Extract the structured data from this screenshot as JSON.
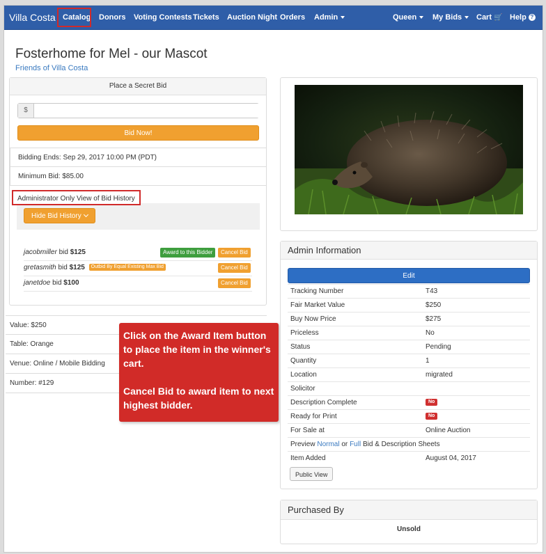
{
  "nav": {
    "brand": "Villa Costa",
    "items": [
      "Catalog",
      "Donors",
      "Voting Contests",
      "Tickets",
      "Auction Night",
      "Orders",
      "Admin"
    ],
    "right": [
      "Queen",
      "My Bids",
      "Cart",
      "Help"
    ]
  },
  "page": {
    "title": "Fosterhome for Mel - our Mascot",
    "subtitle": "Friends of Villa Costa"
  },
  "bid_panel": {
    "header": "Place a Secret Bid",
    "currency": "$",
    "amount_value": "",
    "bid_button": "Bid Now!",
    "bidding_ends": "Bidding Ends: Sep 29, 2017 10:00 PM (PDT)",
    "minimum_bid": "Minimum Bid: $85.00",
    "admin_view_label": "Administrator Only View of Bid History",
    "hide_history_button": "Hide Bid History",
    "bid_word": "bid",
    "bids": [
      {
        "bidder": "jacobmiller",
        "amount": "$125",
        "tag": "",
        "award": "Award to this Bidder",
        "cancel": "Cancel Bid"
      },
      {
        "bidder": "gretasmith",
        "amount": "$125",
        "tag": "Outbid By Equal Existing Max Bid",
        "award": "",
        "cancel": "Cancel Bid"
      },
      {
        "bidder": "janetdoe",
        "amount": "$100",
        "tag": "",
        "award": "",
        "cancel": "Cancel Bid"
      }
    ]
  },
  "item_info": {
    "value": "Value: $250",
    "table": "Table: Orange",
    "venue": "Venue: Online / Mobile Bidding",
    "number": "Number: #129"
  },
  "callout": {
    "line1": "Click on the Award Item button to place the item in the winner's cart.",
    "line2": "Cancel Bid to award item to next highest bidder."
  },
  "admin": {
    "title": "Admin Information",
    "edit_button": "Edit",
    "rows": [
      {
        "label": "Tracking Number",
        "value": "T43"
      },
      {
        "label": "Fair Market Value",
        "value": "$250"
      },
      {
        "label": "Buy Now Price",
        "value": "$275"
      },
      {
        "label": "Priceless",
        "value": "No"
      },
      {
        "label": "Status",
        "value": "Pending"
      },
      {
        "label": "Quantity",
        "value": "1"
      },
      {
        "label": "Location",
        "value": "migrated"
      },
      {
        "label": "Solicitor",
        "value": ""
      },
      {
        "label": "Description Complete",
        "value": "No"
      },
      {
        "label": "Ready for Print",
        "value": "No"
      },
      {
        "label": "For Sale at",
        "value": "Online Auction"
      }
    ],
    "preview": {
      "prefix": "Preview",
      "normal": "Normal",
      "or": "or",
      "full": "Full",
      "suffix": "Bid & Description Sheets"
    },
    "item_added_label": "Item Added",
    "item_added_value": "August 04, 2017",
    "public_view_button": "Public View"
  },
  "purchased": {
    "title": "Purchased By",
    "value": "Unsold"
  },
  "colors": {
    "navbar": "#2f5ea8",
    "highlight": "#d02a2a",
    "orange_button": "#f0a030",
    "green_button": "#3e9e3e",
    "edit_button": "#2d6ec4",
    "link": "#3a7ac0"
  }
}
